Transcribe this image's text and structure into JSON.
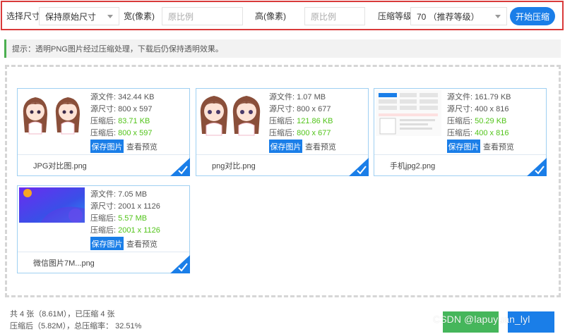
{
  "toolbar": {
    "size_label": "选择尺寸",
    "size_select": "保持原始尺寸",
    "width_label": "宽(像素)",
    "width_placeholder": "原比例",
    "height_label": "高(像素)",
    "height_placeholder": "原比例",
    "level_label": "压缩等级",
    "level_select": "70 （推荐等级）",
    "start_button": "开始压缩"
  },
  "tip": "提示：透明PNG图片经过压缩处理，下载后仍保持透明效果。",
  "labels": {
    "src_file": "源文件:",
    "src_size": "源尺寸:",
    "compressed": "压缩后:",
    "save": "保存图片",
    "preview": "查看预览"
  },
  "files": [
    {
      "src_file": "342.44 KB",
      "src_size": "800 x 597",
      "comp_file": "83.71 KB",
      "comp_size": "800 x 597",
      "name": "JPG对比图.png"
    },
    {
      "src_file": "1.07 MB",
      "src_size": "800 x 677",
      "comp_file": "121.86 KB",
      "comp_size": "800 x 677",
      "name": "png对比.png"
    },
    {
      "src_file": "161.79 KB",
      "src_size": "400 x 816",
      "comp_file": "50.29 KB",
      "comp_size": "400 x 816",
      "name": "手机jpg2.png"
    },
    {
      "src_file": "7.05 MB",
      "src_size": "2001 x 1126",
      "comp_file": "5.57 MB",
      "comp_size": "2001 x 1126",
      "name": "微信图片7M...png"
    }
  ],
  "footer": {
    "line1": "共 4 张（8.61M），已压缩 4 张",
    "line2": "压缩后（5.82M），总压缩率：  32.51%",
    "watermark": "CSDN @lapuyuan_lyl"
  },
  "colors": {
    "accent": "#1a7ee8",
    "green": "#52c41a",
    "highlight": "#d93a3a"
  }
}
